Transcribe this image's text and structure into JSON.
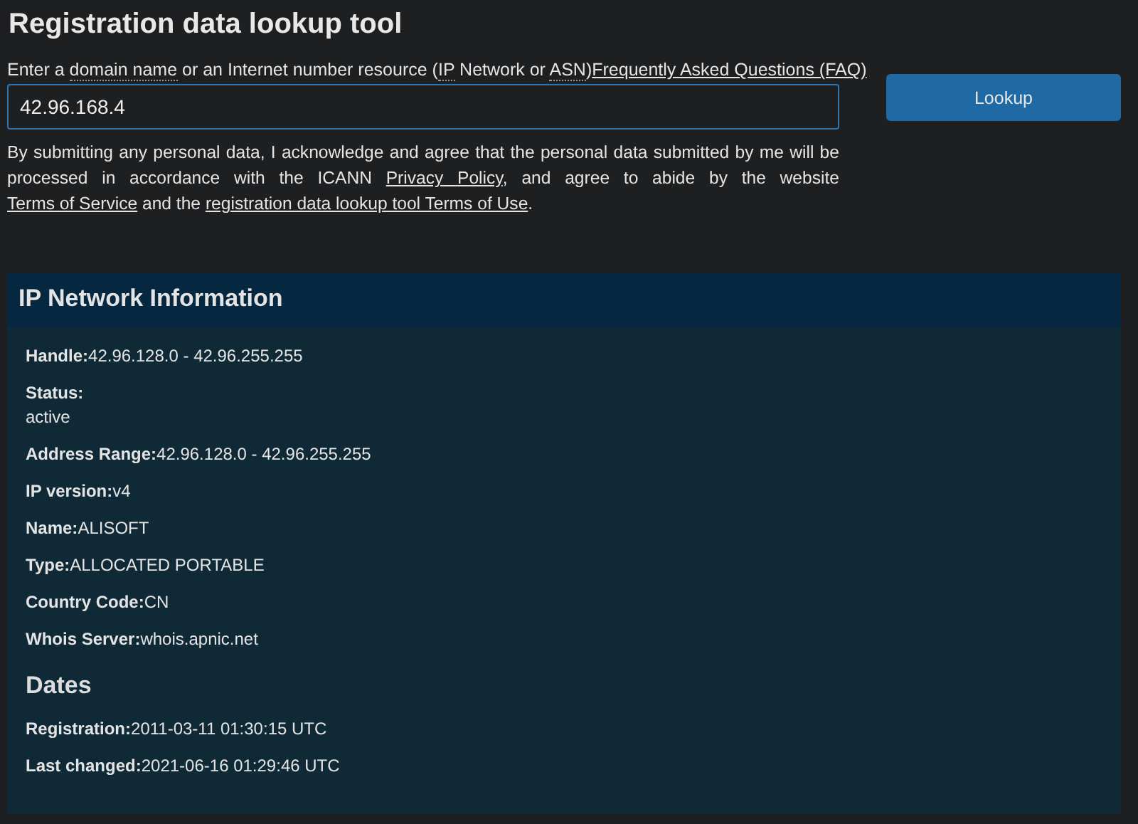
{
  "title": "Registration data lookup tool",
  "prompt": [
    {
      "text": "Enter a ",
      "kind": "plain"
    },
    {
      "text": "domain name",
      "kind": "term"
    },
    {
      "text": " or an Internet number resource (",
      "kind": "plain"
    },
    {
      "text": "IP",
      "kind": "term"
    },
    {
      "text": " Network or ",
      "kind": "plain"
    },
    {
      "text": "ASN",
      "kind": "term"
    },
    {
      "text": ")",
      "kind": "plain"
    }
  ],
  "faq_link": "Frequently Asked Questions (FAQ)",
  "search": {
    "value": "42.96.168.4"
  },
  "lookup_button": "Lookup",
  "consent": [
    {
      "text": "By submitting any personal data, I acknowledge and agree that the personal data submitted by me will be processed in accordance with the ICANN ",
      "kind": "plain"
    },
    {
      "text": "Privacy Policy",
      "kind": "link"
    },
    {
      "text": ", and agree to abide by the website ",
      "kind": "plain"
    },
    {
      "text": "Terms of Service",
      "kind": "link"
    },
    {
      "text": " and the ",
      "kind": "plain"
    },
    {
      "text": "registration data lookup tool Terms of Use",
      "kind": "link"
    },
    {
      "text": ".",
      "kind": "plain"
    }
  ],
  "panel": {
    "title": "IP Network Information",
    "fields": [
      {
        "label": "Handle:",
        "value": "42.96.128.0 - 42.96.255.255",
        "kind": "inline"
      },
      {
        "label": "Status:",
        "value": "active",
        "kind": "block"
      },
      {
        "label": "Address Range:",
        "value": "42.96.128.0 - 42.96.255.255",
        "kind": "inline"
      },
      {
        "label": "IP version:",
        "value": "v4",
        "kind": "inline"
      },
      {
        "label": "Name:",
        "value": "ALISOFT",
        "kind": "inline"
      },
      {
        "label": "Type:",
        "value": "ALLOCATED PORTABLE",
        "kind": "inline"
      },
      {
        "label": "Country Code:",
        "value": "CN",
        "kind": "inline"
      },
      {
        "label": "Whois Server:",
        "value": "whois.apnic.net",
        "kind": "inline"
      }
    ],
    "dates_heading": "Dates",
    "dates": [
      {
        "label": "Registration:",
        "value": "2011-03-11 01:30:15 UTC",
        "kind": "inline"
      },
      {
        "label": "Last changed:",
        "value": "2021-06-16 01:29:46 UTC",
        "kind": "inline"
      }
    ]
  }
}
